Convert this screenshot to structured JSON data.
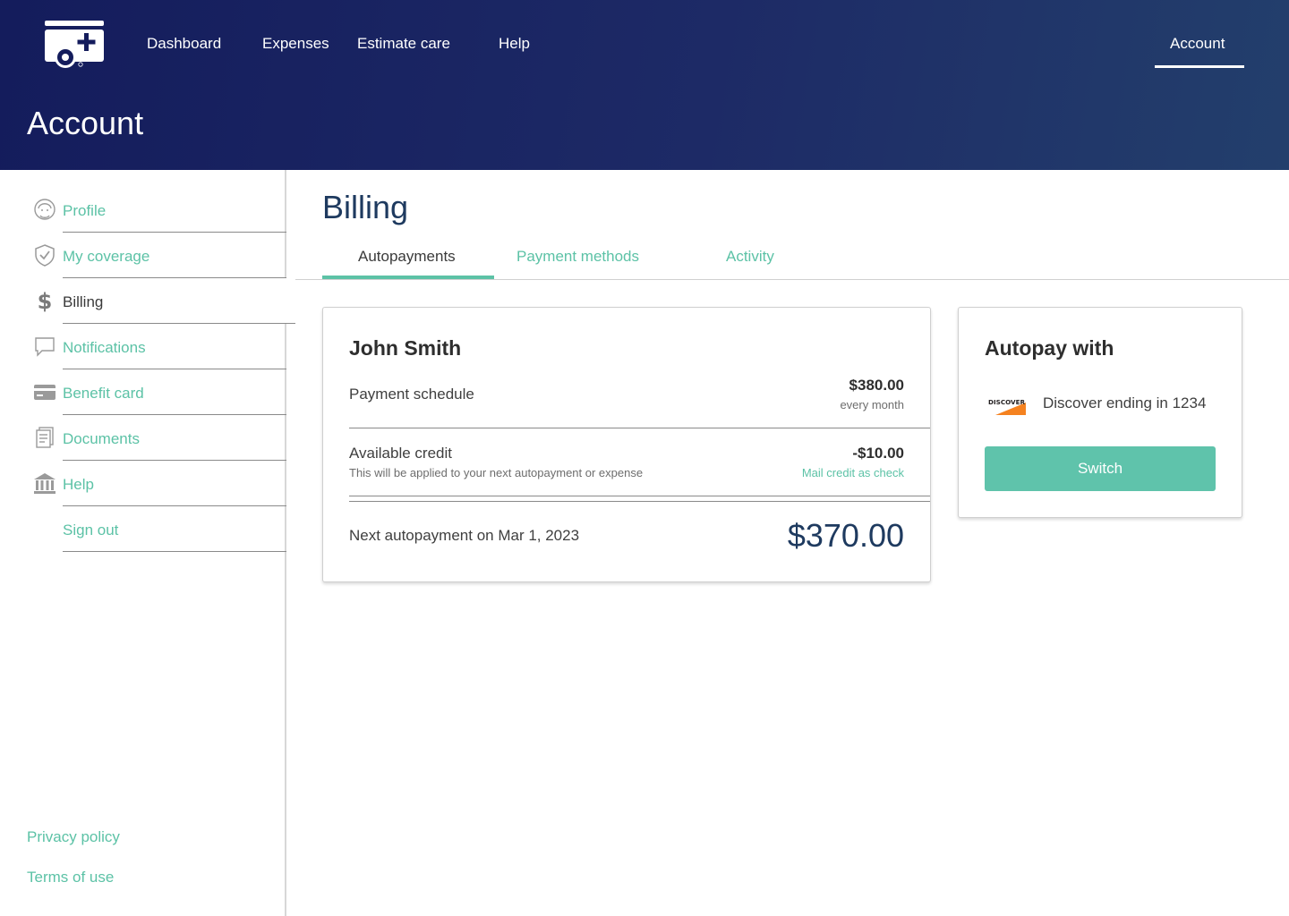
{
  "header": {
    "nav": [
      "Dashboard",
      "Expenses",
      "Estimate care",
      "Help"
    ],
    "account_label": "Account",
    "page_title": "Account"
  },
  "sidebar": {
    "items": [
      {
        "label": "Profile",
        "icon": "person-icon"
      },
      {
        "label": "My coverage",
        "icon": "shield-check-icon"
      },
      {
        "label": "Billing",
        "icon": "dollar-icon",
        "active": true
      },
      {
        "label": "Notifications",
        "icon": "chat-bubble-icon"
      },
      {
        "label": "Benefit card",
        "icon": "credit-card-icon"
      },
      {
        "label": "Documents",
        "icon": "document-icon"
      },
      {
        "label": "Help",
        "icon": "bank-icon"
      },
      {
        "label": "Sign out",
        "icon": ""
      }
    ],
    "footer": {
      "privacy": "Privacy policy",
      "terms": "Terms of use"
    }
  },
  "main": {
    "title": "Billing",
    "tabs": [
      "Autopayments",
      "Payment methods",
      "Activity"
    ],
    "active_tab": "Autopayments",
    "summary": {
      "name": "John Smith",
      "schedule_label": "Payment schedule",
      "schedule_amount": "$380.00",
      "schedule_frequency": "every month",
      "credit_label": "Available credit",
      "credit_note": "This will be applied to your next autopayment or expense",
      "credit_amount": "-$10.00",
      "credit_action": "Mail credit as check",
      "next_label": "Next autopayment on Mar 1, 2023",
      "next_amount": "$370.00"
    },
    "autopay": {
      "title": "Autopay with",
      "card_brand": "DISCOVER",
      "card_text": "Discover ending in 1234",
      "button": "Switch"
    }
  },
  "colors": {
    "header_start": "#141c5c",
    "header_end": "#233f6c",
    "accent": "#5cc2a6",
    "title_blue": "#1e3a5f"
  }
}
